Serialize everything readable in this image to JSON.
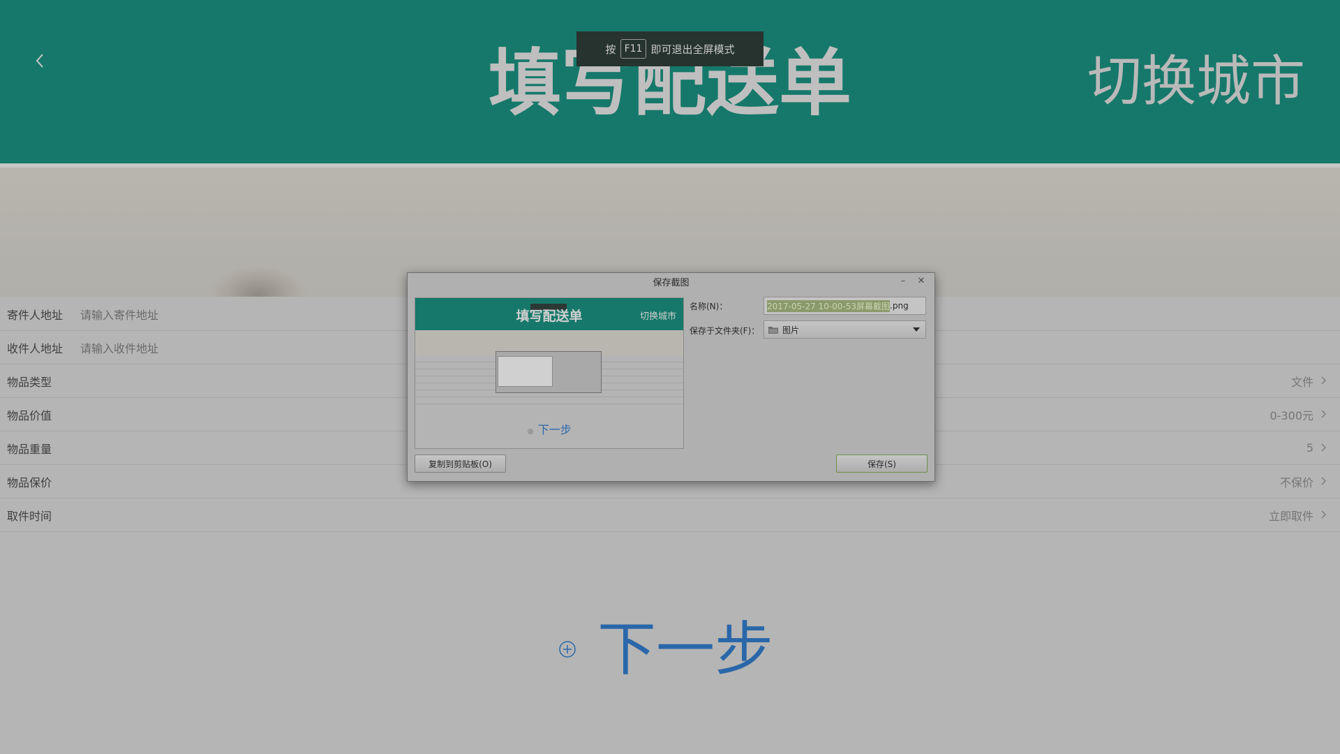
{
  "header": {
    "title": "填写配送单",
    "city_switch": "切换城市"
  },
  "fullscreen_toast": {
    "prefix": "按",
    "key": "F11",
    "suffix": "即可退出全屏模式"
  },
  "form": {
    "rows": [
      {
        "label": "寄件人地址",
        "placeholder": "请输入寄件地址",
        "value": ""
      },
      {
        "label": "收件人地址",
        "placeholder": "请输入收件地址",
        "value": ""
      },
      {
        "label": "物品类型",
        "placeholder": "",
        "value": "文件"
      },
      {
        "label": "物品价值",
        "placeholder": "",
        "value": "0-300元"
      },
      {
        "label": "物品重量",
        "placeholder": "",
        "value": "5"
      },
      {
        "label": "物品保价",
        "placeholder": "",
        "value": "不保价"
      },
      {
        "label": "取件时间",
        "placeholder": "",
        "value": "立即取件"
      }
    ]
  },
  "next_step": "下一步",
  "dialog": {
    "title": "保存截图",
    "name_label": "名称(N)：",
    "filename_selected": "2017-05-27 10-00-53屏幕截图",
    "filename_ext": ".png",
    "folder_label": "保存于文件夹(F)：",
    "folder_value": "图片",
    "copy_button": "复制到剪贴板(O)",
    "save_button": "保存(S)",
    "preview": {
      "title": "填写配送单",
      "city": "切换城市",
      "next": "下一步"
    }
  },
  "colors": {
    "header_bg": "#16786a",
    "accent_blue": "#2a67a9",
    "overlay_gray": "#b5b5b5"
  }
}
